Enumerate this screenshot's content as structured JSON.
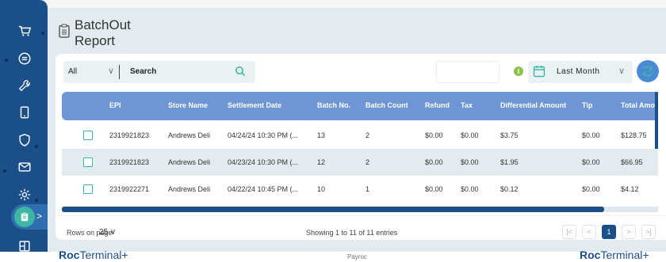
{
  "page": {
    "title": "BatchOut Report"
  },
  "sidebar": {
    "items": [
      {
        "icon": "cart-icon"
      },
      {
        "icon": "receipt-icon"
      },
      {
        "icon": "wrench-icon"
      },
      {
        "icon": "tablet-icon"
      },
      {
        "icon": "shield-icon"
      },
      {
        "icon": "mail-icon"
      },
      {
        "icon": "gear-icon"
      },
      {
        "icon": "clipboard-icon",
        "active": true
      },
      {
        "icon": "grid-icon"
      }
    ],
    "active_chevron": ">"
  },
  "filters": {
    "scope_value": "All",
    "search_label": "Search",
    "date_range_value": "Last Month"
  },
  "table": {
    "columns": [
      "EPI",
      "Store Name",
      "Settlement Date",
      "Batch No.",
      "Batch Count",
      "Refund",
      "Tax",
      "Differential Amount",
      "Tip",
      "Total Amou"
    ],
    "rows": [
      {
        "epi": "2319921823",
        "store": "Andrews Deli",
        "date": "04/24/24 10:30 PM (...",
        "batch_no": "13",
        "batch_count": "2",
        "refund": "$0.00",
        "tax": "$0.00",
        "diff": "$3.75",
        "tip": "$0.00",
        "total": "$128.75"
      },
      {
        "epi": "2319921823",
        "store": "Andrews Deli",
        "date": "04/23/24 10:30 PM (...",
        "batch_no": "12",
        "batch_count": "2",
        "refund": "$0.00",
        "tax": "$0.00",
        "diff": "$1.95",
        "tip": "$0.00",
        "total": "$66.95"
      },
      {
        "epi": "2319922271",
        "store": "Andrews Deli",
        "date": "04/22/24 10:45 PM (...",
        "batch_no": "10",
        "batch_count": "1",
        "refund": "$0.00",
        "tax": "$0.00",
        "diff": "$0.12",
        "tip": "$0.00",
        "total": "$4.12"
      }
    ]
  },
  "pagination": {
    "rows_label": "Rows on page",
    "rows_value": "25",
    "showing": "Showing 1 to 11 of 11 entries",
    "buttons": [
      "|<",
      "<",
      "1",
      ">",
      ">|"
    ],
    "current": "1"
  },
  "footer": {
    "brand_left_a": "Roc",
    "brand_left_b": "Terminal+",
    "center": "Payroc",
    "brand_right_a": "Roc",
    "brand_right_b": "Terminal+"
  },
  "colors": {
    "sidebar": "#1b4f8a",
    "accent": "#3fb7a5",
    "header": "#6f96d4",
    "info": "#8bc34a"
  }
}
